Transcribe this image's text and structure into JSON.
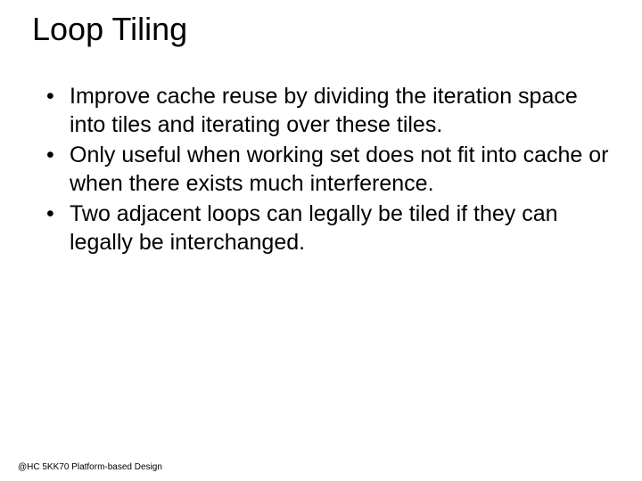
{
  "slide": {
    "title": "Loop Tiling",
    "bullets": [
      "Improve cache reuse by dividing the iteration space into tiles and iterating over these tiles.",
      "Only useful when working set does not fit into cache or when there exists much interference.",
      "Two adjacent loops can legally be tiled if they can legally be interchanged."
    ],
    "footer": "@HC 5KK70 Platform-based Design"
  }
}
